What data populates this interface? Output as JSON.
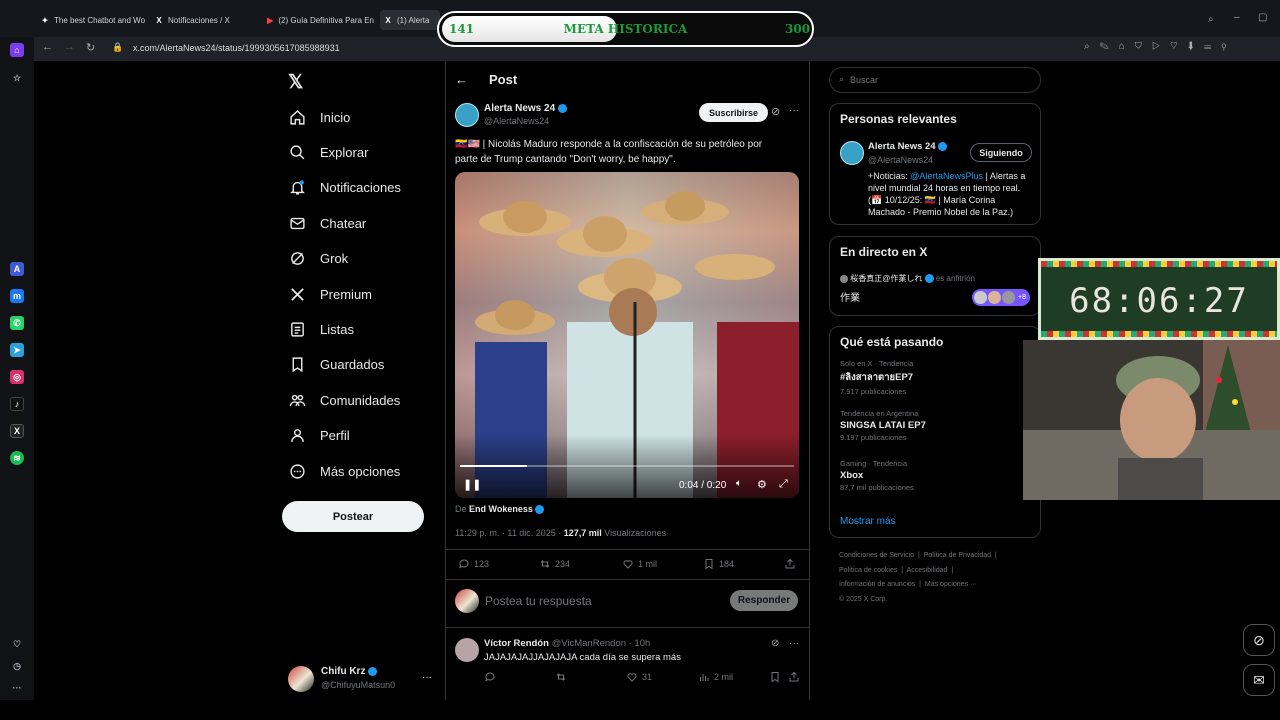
{
  "browser": {
    "tabs": [
      {
        "label": "The best Chatbot and Wo",
        "fav": "✦"
      },
      {
        "label": "Notificaciones / X",
        "fav": "X"
      },
      {
        "label": "(2) Guía Definitiva Para En",
        "fav": "▶"
      },
      {
        "label": "(1) Alerta",
        "fav": "X"
      }
    ],
    "url": "x.com/AlertaNews24/status/1999305617085988931"
  },
  "overlay": {
    "goal_current": "141",
    "goal_label": "META HISTORICA",
    "goal_target": "300",
    "goal_progress": 0.47,
    "timer": "68:06:27"
  },
  "nav": {
    "items": [
      {
        "label": "Inicio",
        "icon": "home-icon"
      },
      {
        "label": "Explorar",
        "icon": "search-icon"
      },
      {
        "label": "Notificaciones",
        "icon": "bell-icon"
      },
      {
        "label": "Chatear",
        "icon": "mail-icon"
      },
      {
        "label": "Grok",
        "icon": "grok-icon"
      },
      {
        "label": "Premium",
        "icon": "x-logo-icon"
      },
      {
        "label": "Listas",
        "icon": "list-icon"
      },
      {
        "label": "Guardados",
        "icon": "bookmark-icon"
      },
      {
        "label": "Comunidades",
        "icon": "communities-icon"
      },
      {
        "label": "Perfil",
        "icon": "person-icon"
      },
      {
        "label": "Más opciones",
        "icon": "more-circle-icon"
      }
    ],
    "post_button": "Postear",
    "account_name": "Chifu Krz",
    "account_handle": "@ChifuyuMatsun0"
  },
  "post": {
    "header": "Post",
    "author_name": "Alerta News 24",
    "author_handle": "@AlertaNews24",
    "subscribe": "Suscribirse",
    "text_line1": "🇻🇪🇺🇸 | Nicolás Maduro responde a la confiscación de su petróleo por",
    "text_line2": "parte de Trump cantando \"Don't worry, be happy\".",
    "video_time": "0:04 / 0:20",
    "video_progress": 0.2,
    "from_prefix": "De",
    "from_name": "End Wokeness",
    "timestamp": "11:29 p. m. · 11 dic. 2025 ·",
    "views_count": "127,7 mil",
    "views_label": "Visualizaciones",
    "replies": "123",
    "reposts": "234",
    "likes": "1 mil",
    "bookmarks": "184",
    "reply_placeholder": "Postea tu respuesta",
    "reply_button": "Responder"
  },
  "reply": {
    "name": "Víctor Rendón",
    "handle": "@VicManRendon · 10h",
    "text": "JAJAJAJAJJAJAJAJA cada día se supera más",
    "reposts": "",
    "likes": "31",
    "views": "2 mil"
  },
  "sidebar": {
    "search_placeholder": "Buscar",
    "relevant_title": "Personas relevantes",
    "rel_name": "Alerta News 24",
    "rel_handle": "@AlertaNews24",
    "following": "Siguiendo",
    "bio_prefix": "+Noticias:",
    "bio_link": "@AlertaNewsPlus",
    "bio_rest": "| Alertas a nivel mundial 24 horas en tiempo real. (📅 10/12/25: 🇻🇪 | María Corina Machado - Premio Nobel de la Paz.)",
    "live_title": "En directo en X",
    "live_host": "桜香真正@作業しれ",
    "live_host_suffix": "es anfitrión",
    "live_topic": "作業",
    "live_extra": "+8",
    "trends_title": "Qué está pasando",
    "trends": [
      {
        "context": "Solo en X · Tendencia",
        "name": "#ลิงสาลาตายEP7",
        "count": "7.917 publicaciones"
      },
      {
        "context": "Tendencia en Argentina",
        "name": "SINGSA LATAI EP7",
        "count": "9.197 publicaciones"
      },
      {
        "context": "Gaming · Tendencia",
        "name": "Xbox",
        "count": "87,7 mil publicaciones"
      }
    ],
    "show_more": "Mostrar más",
    "footer": [
      "Condiciones de Servicio",
      "Política de Privacidad",
      "Política de cookies",
      "Accesibilidad",
      "Información de anuncios",
      "Más opciones ···",
      "© 2025 X Corp."
    ]
  },
  "colors": {
    "accent": "#1d9bf0",
    "goal_text": "#1a9a3a",
    "timer_text": "#e9e4de"
  }
}
